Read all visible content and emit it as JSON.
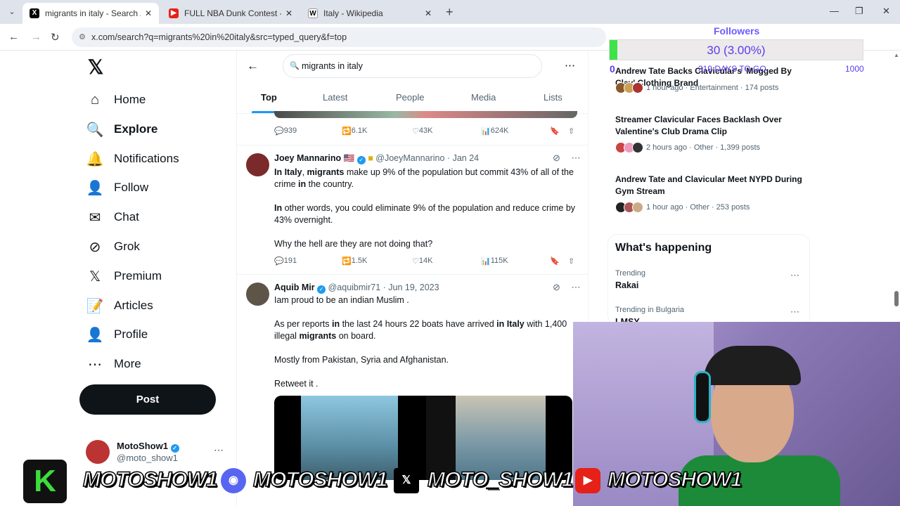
{
  "browser": {
    "tabs": [
      {
        "title": "migrants in italy - Search / X",
        "favicon": "X",
        "active": true
      },
      {
        "title": "FULL NBA Dunk Contest - All St",
        "favicon": "▶",
        "active": false
      },
      {
        "title": "Italy - Wikipedia",
        "favicon": "W",
        "active": false
      }
    ],
    "url": "x.com/search?q=migrants%20in%20italy&src=typed_query&f=top"
  },
  "nav": {
    "items": [
      {
        "label": "Home",
        "icon": "home-icon",
        "glyph": "⌂"
      },
      {
        "label": "Explore",
        "icon": "search-icon",
        "glyph": "🔍"
      },
      {
        "label": "Notifications",
        "icon": "bell-icon",
        "glyph": "🔔"
      },
      {
        "label": "Follow",
        "icon": "person-add-icon",
        "glyph": "👤"
      },
      {
        "label": "Chat",
        "icon": "mail-icon",
        "glyph": "✉"
      },
      {
        "label": "Grok",
        "icon": "grok-icon",
        "glyph": "⊘"
      },
      {
        "label": "Premium",
        "icon": "x-logo-icon",
        "glyph": "𝕏"
      },
      {
        "label": "Articles",
        "icon": "article-icon",
        "glyph": "📝"
      },
      {
        "label": "Profile",
        "icon": "profile-icon",
        "glyph": "👤"
      },
      {
        "label": "More",
        "icon": "more-circle-icon",
        "glyph": "⋯"
      }
    ],
    "post_label": "Post",
    "account": {
      "name": "MotoShow1",
      "handle": "@moto_show1"
    }
  },
  "search": {
    "query": "migrants in italy",
    "tabs": [
      "Top",
      "Latest",
      "People",
      "Media",
      "Lists"
    ]
  },
  "tweets": [
    {
      "stats": {
        "replies": "939",
        "retweets": "6.1K",
        "likes": "43K",
        "views": "624K"
      }
    },
    {
      "name": "Joey Mannarino",
      "flag": "🇺🇸",
      "handle": "@JoeyMannarino",
      "date": "Jan 24",
      "paragraphs": [
        [
          {
            "t": "In Italy",
            "b": true
          },
          {
            "t": ", ",
            "b": false
          },
          {
            "t": "migrants",
            "b": true
          },
          {
            "t": " make up 9% of the population but commit 43% of all of the crime ",
            "b": false
          },
          {
            "t": "in",
            "b": true
          },
          {
            "t": " the country.",
            "b": false
          }
        ],
        [
          {
            "t": "In",
            "b": true
          },
          {
            "t": " other words, you could eliminate 9% of the population and reduce crime by 43% overnight.",
            "b": false
          }
        ],
        [
          {
            "t": "Why the hell are they are not doing that?",
            "b": false
          }
        ]
      ],
      "stats": {
        "replies": "191",
        "retweets": "1.5K",
        "likes": "14K",
        "views": "115K"
      }
    },
    {
      "name": "Aquib Mir",
      "handle": "@aquibmir71",
      "date": "Jun 19, 2023",
      "paragraphs": [
        [
          {
            "t": "Iam proud to be an indian Muslim .",
            "b": false
          }
        ],
        [
          {
            "t": "As per reports ",
            "b": false
          },
          {
            "t": "in",
            "b": true
          },
          {
            "t": " the last 24 hours 22 boats have arrived ",
            "b": false
          },
          {
            "t": "in Italy",
            "b": true
          },
          {
            "t": " with 1,400 illegal ",
            "b": false
          },
          {
            "t": "migrants",
            "b": true
          },
          {
            "t": " on board.",
            "b": false
          }
        ],
        [
          {
            "t": "Mostly from Pakistan, Syria and Afghanistan.",
            "b": false
          }
        ],
        [
          {
            "t": "Retweet it .",
            "b": false
          }
        ]
      ]
    }
  ],
  "trends": [
    {
      "title": "Andrew Tate Backs Clavicular's 'Mogged By Clav' Clothing Brand",
      "meta": "1 hour ago · Entertainment · 174 posts"
    },
    {
      "title": "Streamer Clavicular Faces Backlash Over Valentine's Club Drama Clip",
      "meta": "2 hours ago · Other · 1,399 posts"
    },
    {
      "title": "Andrew Tate and Clavicular Meet NYPD During Gym Stream",
      "meta": "1 hour ago · Other · 253 posts"
    }
  ],
  "happening": {
    "title": "What's happening",
    "items": [
      {
        "context": "Trending",
        "name": "Rakai"
      },
      {
        "context": "Trending in Bulgaria",
        "name": "LMSY"
      }
    ]
  },
  "overlay": {
    "followers_label": "Followers",
    "followers_count": "30 (3.00%)",
    "progress": 0.03,
    "start": "0",
    "days": "319 DAYS TO GO",
    "goal": "1000"
  },
  "banner": {
    "k_letter": "K",
    "items": [
      "MOTOSHOW1",
      "MOTOSHOW1",
      "MOTO_SHOW1",
      "MOTOSHOW1"
    ]
  },
  "colors": {
    "accent": "#1d9bf0",
    "post_button": "#0f1419",
    "progress": "#3ee24a"
  }
}
